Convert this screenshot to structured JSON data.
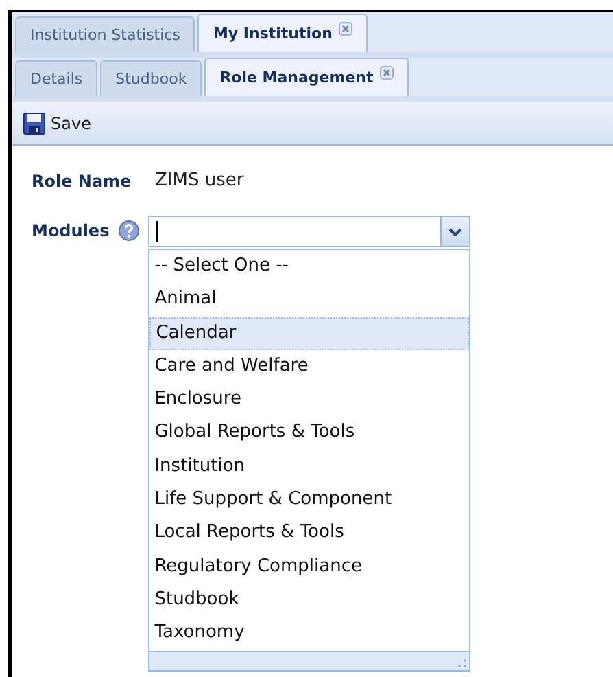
{
  "outer_tabs": [
    {
      "label": "Institution Statistics",
      "selected": false,
      "closable": false
    },
    {
      "label": "My Institution",
      "selected": true,
      "closable": true
    }
  ],
  "inner_tabs": [
    {
      "label": "Details",
      "selected": false,
      "closable": false
    },
    {
      "label": "Studbook",
      "selected": false,
      "closable": false
    },
    {
      "label": "Role Management",
      "selected": true,
      "closable": true
    }
  ],
  "toolbar": {
    "save": "Save"
  },
  "form": {
    "role_name_label": "Role Name",
    "role_name": "ZIMS user",
    "modules_label": "Modules"
  },
  "dropdown": {
    "options": [
      {
        "label": "-- Select One --",
        "selected": false
      },
      {
        "label": "Animal",
        "selected": false
      },
      {
        "label": "Calendar",
        "selected": true
      },
      {
        "label": "Care and Welfare",
        "selected": false
      },
      {
        "label": "Enclosure",
        "selected": false
      },
      {
        "label": "Global Reports & Tools",
        "selected": false
      },
      {
        "label": "Institution",
        "selected": false
      },
      {
        "label": "Life Support & Component",
        "selected": false
      },
      {
        "label": "Local Reports & Tools",
        "selected": false
      },
      {
        "label": "Regulatory Compliance",
        "selected": false
      },
      {
        "label": "Studbook",
        "selected": false
      },
      {
        "label": "Taxonomy",
        "selected": false
      }
    ]
  }
}
